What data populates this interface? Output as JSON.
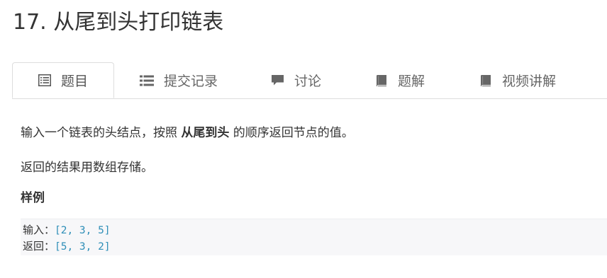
{
  "page": {
    "title": "17. 从尾到头打印链表"
  },
  "tabs": [
    {
      "label": "题目",
      "icon": "list-alt-icon",
      "active": true
    },
    {
      "label": "提交记录",
      "icon": "list-icon",
      "active": false
    },
    {
      "label": "讨论",
      "icon": "comment-icon",
      "active": false
    },
    {
      "label": "题解",
      "icon": "book-icon",
      "active": false
    },
    {
      "label": "视频讲解",
      "icon": "book-icon",
      "active": false
    }
  ],
  "problem": {
    "desc_before": "输入一个链表的头结点，按照 ",
    "desc_bold": "从尾到头",
    "desc_after": " 的顺序返回节点的值。",
    "desc2": "返回的结果用数组存储。",
    "example_heading": "样例",
    "example_input_label": "输入：",
    "example_input_value": "[2, 3, 5]",
    "example_output_label": "返回：",
    "example_output_value": "[5, 3, 2]"
  },
  "colors": {
    "accent_code_value": "#2f8fb8",
    "tab_border": "#dddddd",
    "code_bg": "#f7f7f9"
  }
}
